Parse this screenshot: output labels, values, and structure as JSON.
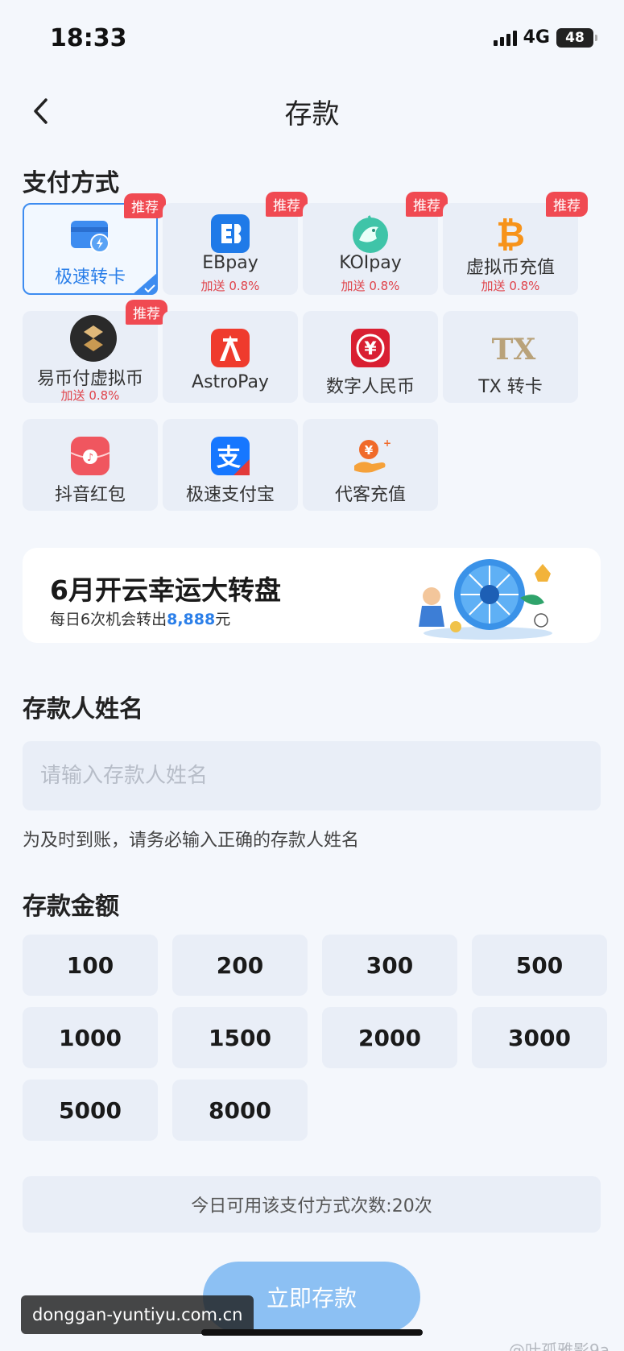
{
  "status": {
    "time": "18:33",
    "network": "4G",
    "battery": "48"
  },
  "nav": {
    "title": "存款"
  },
  "payment": {
    "section_title": "支付方式",
    "methods": [
      {
        "label": "极速转卡",
        "badge": "推荐",
        "bonus": "",
        "icon": "card-lightning-icon"
      },
      {
        "label": "EBpay",
        "badge": "推荐",
        "bonus": "加送 0.8%",
        "icon": "ebpay-logo-icon"
      },
      {
        "label": "KOIpay",
        "badge": "推荐",
        "bonus": "加送 0.8%",
        "icon": "koi-fish-icon"
      },
      {
        "label": "虚拟币充值",
        "badge": "推荐",
        "bonus": "加送 0.8%",
        "icon": "bitcoin-icon"
      },
      {
        "label": "易币付虚拟币",
        "badge": "推荐",
        "bonus": "加送 0.8%",
        "icon": "yibifu-logo-icon"
      },
      {
        "label": "AstroPay",
        "badge": "",
        "bonus": "",
        "icon": "astropay-logo-icon"
      },
      {
        "label": "数字人民币",
        "badge": "",
        "bonus": "",
        "icon": "digital-rmb-icon"
      },
      {
        "label": "TX 转卡",
        "badge": "",
        "bonus": "",
        "icon": "tx-logo-icon"
      },
      {
        "label": "抖音红包",
        "badge": "",
        "bonus": "",
        "icon": "red-packet-icon"
      },
      {
        "label": "极速支付宝",
        "badge": "",
        "bonus": "",
        "icon": "alipay-icon"
      },
      {
        "label": "代客充值",
        "badge": "",
        "bonus": "",
        "icon": "hand-coin-icon"
      }
    ]
  },
  "banner": {
    "title": "6月开云幸运大转盘",
    "subtitle_prefix": "每日6次机会转出",
    "subtitle_amount": "8,888",
    "subtitle_suffix": "元"
  },
  "depositor": {
    "section_title": "存款人姓名",
    "placeholder": "请输入存款人姓名",
    "value": "",
    "hint": "为及时到账，请务必输入正确的存款人姓名"
  },
  "amount": {
    "section_title": "存款金额",
    "options": [
      "100",
      "200",
      "300",
      "500",
      "1000",
      "1500",
      "2000",
      "3000",
      "5000",
      "8000"
    ]
  },
  "usage_text": "今日可用该支付方式次数:20次",
  "submit_label": "立即存款",
  "watermark": {
    "url": "donggan-yuntiyu.com.cn",
    "author": "@叶孤雅影9a"
  },
  "colors": {
    "accent": "#3d8cf0",
    "badge": "#f04a52",
    "bonus": "#e0434a",
    "submit": "#8cc0f3"
  }
}
